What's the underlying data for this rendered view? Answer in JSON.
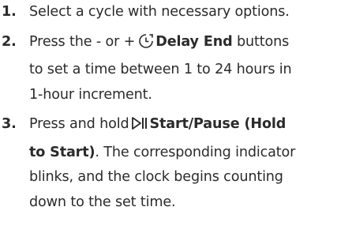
{
  "steps": [
    {
      "number": "1.",
      "text": "Select a cycle with necessary options."
    },
    {
      "number": "2.",
      "pre": "Press the - or +",
      "button_icon": "clock-icon",
      "button_label": "Delay End",
      "post_first_line": "buttons",
      "line2": "to set a time between 1 to 24 hours in",
      "line3": "1-hour increment."
    },
    {
      "number": "3.",
      "pre": "Press and hold",
      "button_icon": "play-pause-icon",
      "button_label_line1": "Start/Pause (Hold",
      "button_label_line2": "to Start)",
      "post_line2": ". The corresponding indicator",
      "line3": "blinks, and the clock begins counting",
      "line4": "down to the set time."
    }
  ]
}
